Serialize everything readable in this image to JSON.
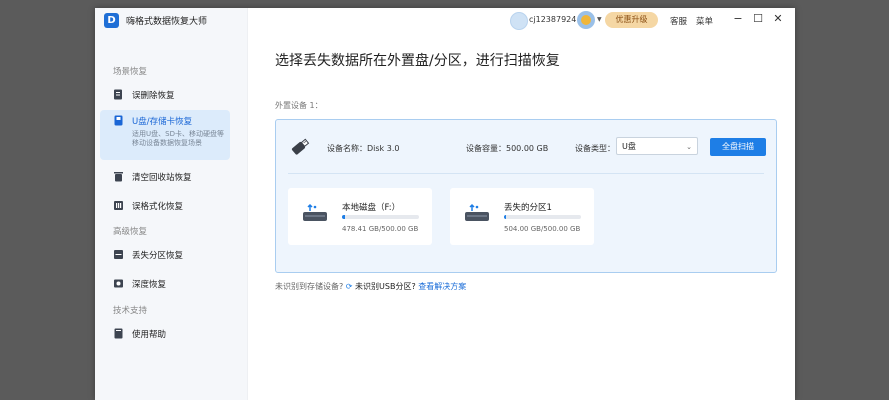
{
  "app": {
    "title": "嗨格式数据恢复大师",
    "logo_letter": "D"
  },
  "sidebar": {
    "sections": [
      {
        "label": "场景恢复"
      },
      {
        "label": "高级恢复"
      },
      {
        "label": "技术支持"
      }
    ],
    "items": [
      {
        "label": "误删除恢复",
        "icon": "trash-file-icon"
      },
      {
        "label": "U盘/存储卡恢复",
        "icon": "usb-card-icon",
        "active": true,
        "sub1": "适用U盘、SD卡、移动硬盘等",
        "sub2": "移动设备数据恢复场景"
      },
      {
        "label": "清空回收站恢复",
        "icon": "recycle-bin-icon"
      },
      {
        "label": "误格式化恢复",
        "icon": "format-icon"
      },
      {
        "label": "丢失分区恢复",
        "icon": "partition-icon"
      },
      {
        "label": "深度恢复",
        "icon": "deep-scan-icon"
      },
      {
        "label": "使用帮助",
        "icon": "help-book-icon"
      }
    ]
  },
  "titlebar": {
    "username": "cj12387924",
    "upgrade": "优惠升级",
    "service": "客服",
    "menu": "菜单",
    "minimize": "−",
    "maximize": "☐",
    "close": "✕"
  },
  "main": {
    "title": "选择丢失数据所在外置盘/分区，进行扫描恢复",
    "external_label": "外置设备 1：",
    "device": {
      "name_label": "设备名称：",
      "name": "Disk 3.0",
      "capacity_label": "设备容量：",
      "capacity": "500.00 GB",
      "type_label": "设备类型：",
      "type": "U盘",
      "scan_button": "全盘扫描"
    },
    "disks": [
      {
        "name": "本地磁盘（F:）",
        "size": "478.41 GB/500.00 GB",
        "used_fraction": 0.04
      },
      {
        "name": "丢失的分区1",
        "size": "504.00 GB/500.00 GB",
        "used_fraction": 0.02
      }
    ],
    "bottom": {
      "q": "未识别到存储设备?",
      "usb": "未识别USB分区?",
      "solution": "查看解决方案"
    }
  },
  "colors": {
    "accent": "#1e7ee6",
    "panel_bg": "#eef5fd",
    "panel_border": "#a9cdf0",
    "upgrade_bg": "#f5d7a4"
  }
}
